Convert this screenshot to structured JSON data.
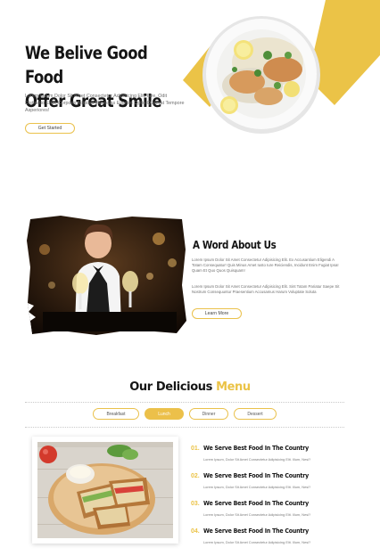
{
  "hero": {
    "title_line1": "We Belive Good Food",
    "title_line2": "Offer Great Smile",
    "description": "Lorem Ipsum Dolor Sit Amet Consectetur Adipisicing Elit. Iure, Odit Distinctio Error Corporis Adipisci Molestias Eveniet Optio Quaerat Tempore Asperiores!",
    "cta_label": "Get Started"
  },
  "about": {
    "title": "A Word About Us",
    "paragraph1": "Lorem Ipsum Dolor Sit Amet Consectetur Adipisicing Elit. Ex Accusantium Eligendi A Totam Consequatur! Quis Minus Amet Iusto Iure Reiciendis, Incidunt Enim Fugiat Ipsa! Quam Et Quo Quos Quisquam!",
    "paragraph2": "Lorem Ipsum Dolor Sit Amet Consectetur Adipisicing Elit. Sint Totam Pariatur Saepe Sit Nostrum Consequuntur Praesentium Accusamus Harum Voluptate Soluta",
    "cta_label": "Learn More"
  },
  "menu": {
    "title_main": "Our Delicious",
    "title_accent": "Menu",
    "tabs": [
      {
        "label": "Breakfast",
        "active": false
      },
      {
        "label": "Lunch",
        "active": true
      },
      {
        "label": "Dinner",
        "active": false
      },
      {
        "label": "Dessert",
        "active": false
      }
    ],
    "items": [
      {
        "number": "01.",
        "title": "We Serve Best Food In The Country",
        "description": "Lorem Ipsum, Dolor Sit Amet Consectetur Adipisicing Elit. Illum, Nesi?"
      },
      {
        "number": "02.",
        "title": "We Serve Best Food In The Country",
        "description": "Lorem Ipsum, Dolor Sit Amet Consectetur Adipisicing Elit. Illum, Nesi?"
      },
      {
        "number": "03.",
        "title": "We Serve Best Food In The Country",
        "description": "Lorem Ipsum, Dolor Sit Amet Consectetur Adipisicing Elit. Illum, Nesi?"
      },
      {
        "number": "04.",
        "title": "We Serve Best Food In The Country",
        "description": "Lorem Ipsum, Dolor Sit Amet Consectetur Adipisicing Elit. Illum, Nesi?"
      }
    ]
  },
  "colors": {
    "accent": "#ebc347",
    "text_dark": "#151515",
    "text_muted": "#6f6f6f"
  },
  "icons": [
    "plated-meal-image",
    "waitress-photo",
    "sandwich-plate-image"
  ]
}
